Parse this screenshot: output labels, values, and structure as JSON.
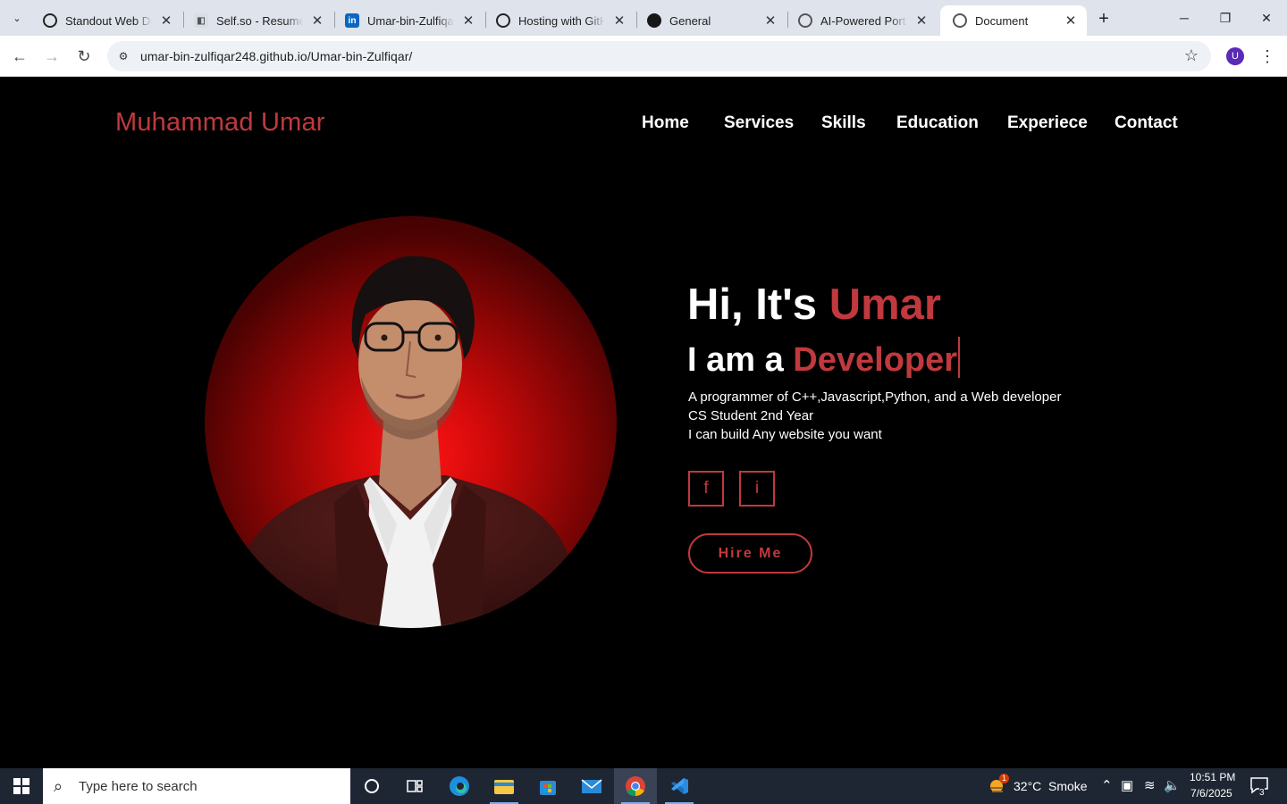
{
  "browser": {
    "tab_search_glyph": "⌄",
    "tabs": [
      {
        "title": "Standout Web Developer",
        "favicon": "openai-icon"
      },
      {
        "title": "Self.so - Resume to website",
        "favicon": "selfso-icon"
      },
      {
        "title": "Umar-bin-Zulfiqar | LinkedIn",
        "favicon": "linkedin-icon"
      },
      {
        "title": "Hosting with GitHub Pages",
        "favicon": "openai-icon"
      },
      {
        "title": "General",
        "favicon": "github-icon"
      },
      {
        "title": "AI-Powered Portfolio",
        "favicon": "globe-icon"
      },
      {
        "title": "Document",
        "favicon": "globe-icon"
      }
    ],
    "url": "umar-bin-zulfiqar248.github.io/Umar-bin-Zulfiqar/",
    "profile_initial": "U"
  },
  "site": {
    "logo": "Muhammad Umar",
    "nav": [
      "Home",
      "Services",
      "Skills",
      "Education",
      "Experiece",
      "Contact"
    ],
    "hero": {
      "greeting_prefix": "Hi, It's ",
      "greeting_name": "Umar",
      "role_prefix": "I am a ",
      "role": "Developer",
      "lines": [
        "A programmer of C++,Javascript,Python, and a Web developer",
        "CS Student 2nd Year",
        "I can build Any website you want"
      ],
      "social": [
        {
          "label": "f",
          "icon": "facebook-icon"
        },
        {
          "label": "i",
          "icon": "instagram-icon"
        }
      ],
      "hire_label": "Hire Me"
    },
    "colors": {
      "accent": "#c0393e",
      "background": "#000000",
      "text": "#ffffff"
    }
  },
  "taskbar": {
    "search_placeholder": "Type here to search",
    "weather_temp": "32°C",
    "weather_desc": "Smoke",
    "weather_badge": "1",
    "time": "10:51 PM",
    "date": "7/6/2025",
    "notification_count": "3"
  }
}
